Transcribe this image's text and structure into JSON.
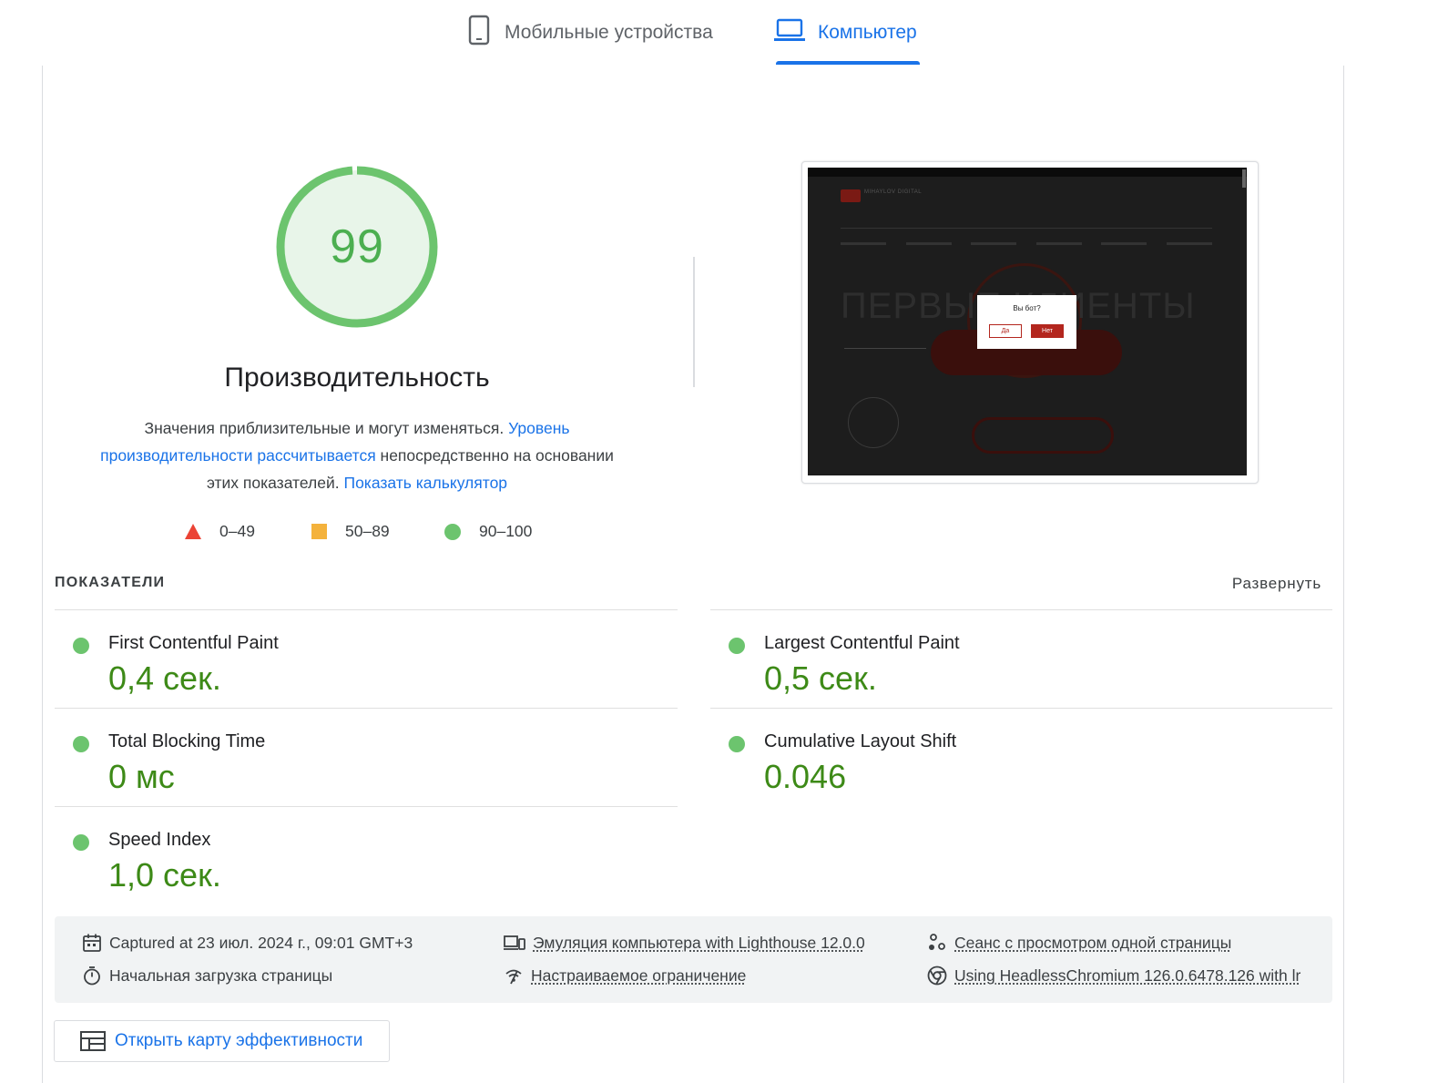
{
  "tabs": {
    "mobile_label": "Мобильные устройства",
    "desktop_label": "Компьютер",
    "active": "desktop"
  },
  "score": {
    "value": "99",
    "gauge_fraction": 0.99,
    "title": "Производительность",
    "color": "#4caf50"
  },
  "description": {
    "text1": "Значения приблизительные и могут изменяться. ",
    "link1": "Уровень производительности рассчитывается",
    "text2": " непосредственно на основании этих показателей. ",
    "link2": "Показать калькулятор"
  },
  "legend": [
    {
      "label": "0–49",
      "color": "#eb4335",
      "shape": "triangle"
    },
    {
      "label": "50–89",
      "color": "#f4b23c",
      "shape": "square"
    },
    {
      "label": "90–100",
      "color": "#6cc46e",
      "shape": "circle"
    }
  ],
  "screenshot": {
    "page_headline": "ПЕРВЫЕ КЛИЕНТЫ",
    "brand": "MIHAYLOV DIGITAL",
    "dialog_title": "Вы бот?",
    "dialog_yes": "Да",
    "dialog_no": "Нет"
  },
  "metrics": {
    "heading": "ПОКАЗАТЕЛИ",
    "expand_label": "Развернуть",
    "items": [
      {
        "name": "First Contentful Paint",
        "value": "0,4 сек.",
        "status": "good"
      },
      {
        "name": "Largest Contentful Paint",
        "value": "0,5 сек.",
        "status": "good"
      },
      {
        "name": "Total Blocking Time",
        "value": "0 мс",
        "status": "good"
      },
      {
        "name": "Cumulative Layout Shift",
        "value": "0.046",
        "status": "good"
      },
      {
        "name": "Speed Index",
        "value": "1,0 сек.",
        "status": "good"
      }
    ]
  },
  "run_info": {
    "captured": "Captured at 23 июл. 2024 г., 09:01 GMT+3",
    "load_type": "Начальная загрузка страницы",
    "emulation": "Эмуляция компьютера with Lighthouse 12.0.0",
    "throttling": "Настраиваемое ограничение",
    "session": "Сеанс с просмотром одной страницы",
    "browser": "Using HeadlessChromium 126.0.6478.126 with lr"
  },
  "treemap_button": "Открыть карту эффективности",
  "colors": {
    "accent": "#1a73e8",
    "good": "#6cc46e",
    "good_text": "#3d8a17"
  }
}
